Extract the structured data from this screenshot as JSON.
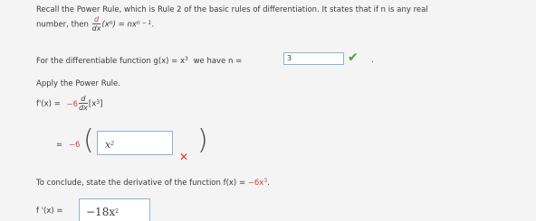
{
  "intro": {
    "line1": "Recall the Power Rule, which is Rule 2 of the basic rules of differentiation. It states that if n is any real",
    "prefix": "number, then",
    "d": "d",
    "dx": "dx",
    "expr": "(x",
    "n": "n",
    "expr2": ") = nx",
    "exp": "n − 1",
    "period": "."
  },
  "question": {
    "text": "For the differentiable function g(x) = x",
    "exp": "3",
    "text2": "we have n =",
    "answer": "3",
    "dot": "."
  },
  "apply": {
    "text": "Apply the Power Rule."
  },
  "step1": {
    "lhs": "f'(x) =",
    "coef": "−6",
    "d": "d",
    "dx": "dx",
    "expr": "[x",
    "exp": "3",
    "close": "]"
  },
  "step2": {
    "eq": "=",
    "coef": "−6",
    "answer": "x",
    "answer_exp": "2"
  },
  "conclude": {
    "text": "To conclude, state the derivative of the function f(x) =",
    "expr": "−6x",
    "exp": "3",
    "period": "."
  },
  "final": {
    "lhs": "f '(x) =",
    "answer": "−18x",
    "answer_exp": "2"
  }
}
